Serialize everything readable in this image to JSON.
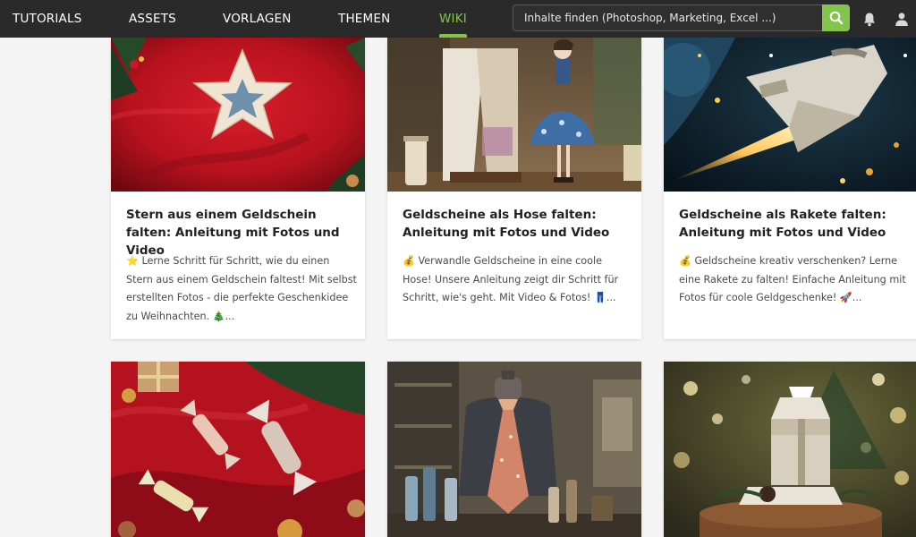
{
  "nav": {
    "items": [
      {
        "label": "TUTORIALS",
        "active": false
      },
      {
        "label": "ASSETS",
        "active": false
      },
      {
        "label": "VORLAGEN",
        "active": false
      },
      {
        "label": "THEMEN",
        "active": false
      },
      {
        "label": "WIKI",
        "active": true
      }
    ],
    "search_placeholder": "Inhalte finden (Photoshop, Marketing, Excel ...)",
    "icons": [
      "search-icon",
      "bell-icon",
      "user-icon"
    ],
    "accent": "#84c34c",
    "bar_color": "#2a2a2a"
  },
  "cards": [
    {
      "title": "Stern aus einem Geldschein falten: Anleitung mit Fotos und Video",
      "excerpt": "⭐ Lerne Schritt für Schritt, wie du einen Stern aus einem Geldschein faltest! Mit selbst erstellten Fotos - die perfekte Geschenkidee zu Weihnachten. 🎄...",
      "image": "origami-star-on-red-fabric"
    },
    {
      "title": "Geldscheine als Hose falten: Anleitung mit Fotos und Video",
      "excerpt": "💰 Verwandle Geldscheine in eine coole Hose! Unsere Anleitung zeigt dir Schritt für Schritt, wie's geht. Mit Video & Fotos! 👖...",
      "image": "money-trousers-and-doll"
    },
    {
      "title": "Geldscheine als Rakete falten: Anleitung mit Fotos und Video",
      "excerpt": "💰 Geldscheine kreativ verschenken? Lerne eine Rakete zu falten! Einfache Anleitung mit Fotos für coole Geldgeschenke! 🚀...",
      "image": "money-rocket-in-space"
    },
    {
      "image": "money-candies-on-red-fabric"
    },
    {
      "image": "money-tie-on-mannequin"
    },
    {
      "image": "money-gift-box-on-wood"
    }
  ]
}
